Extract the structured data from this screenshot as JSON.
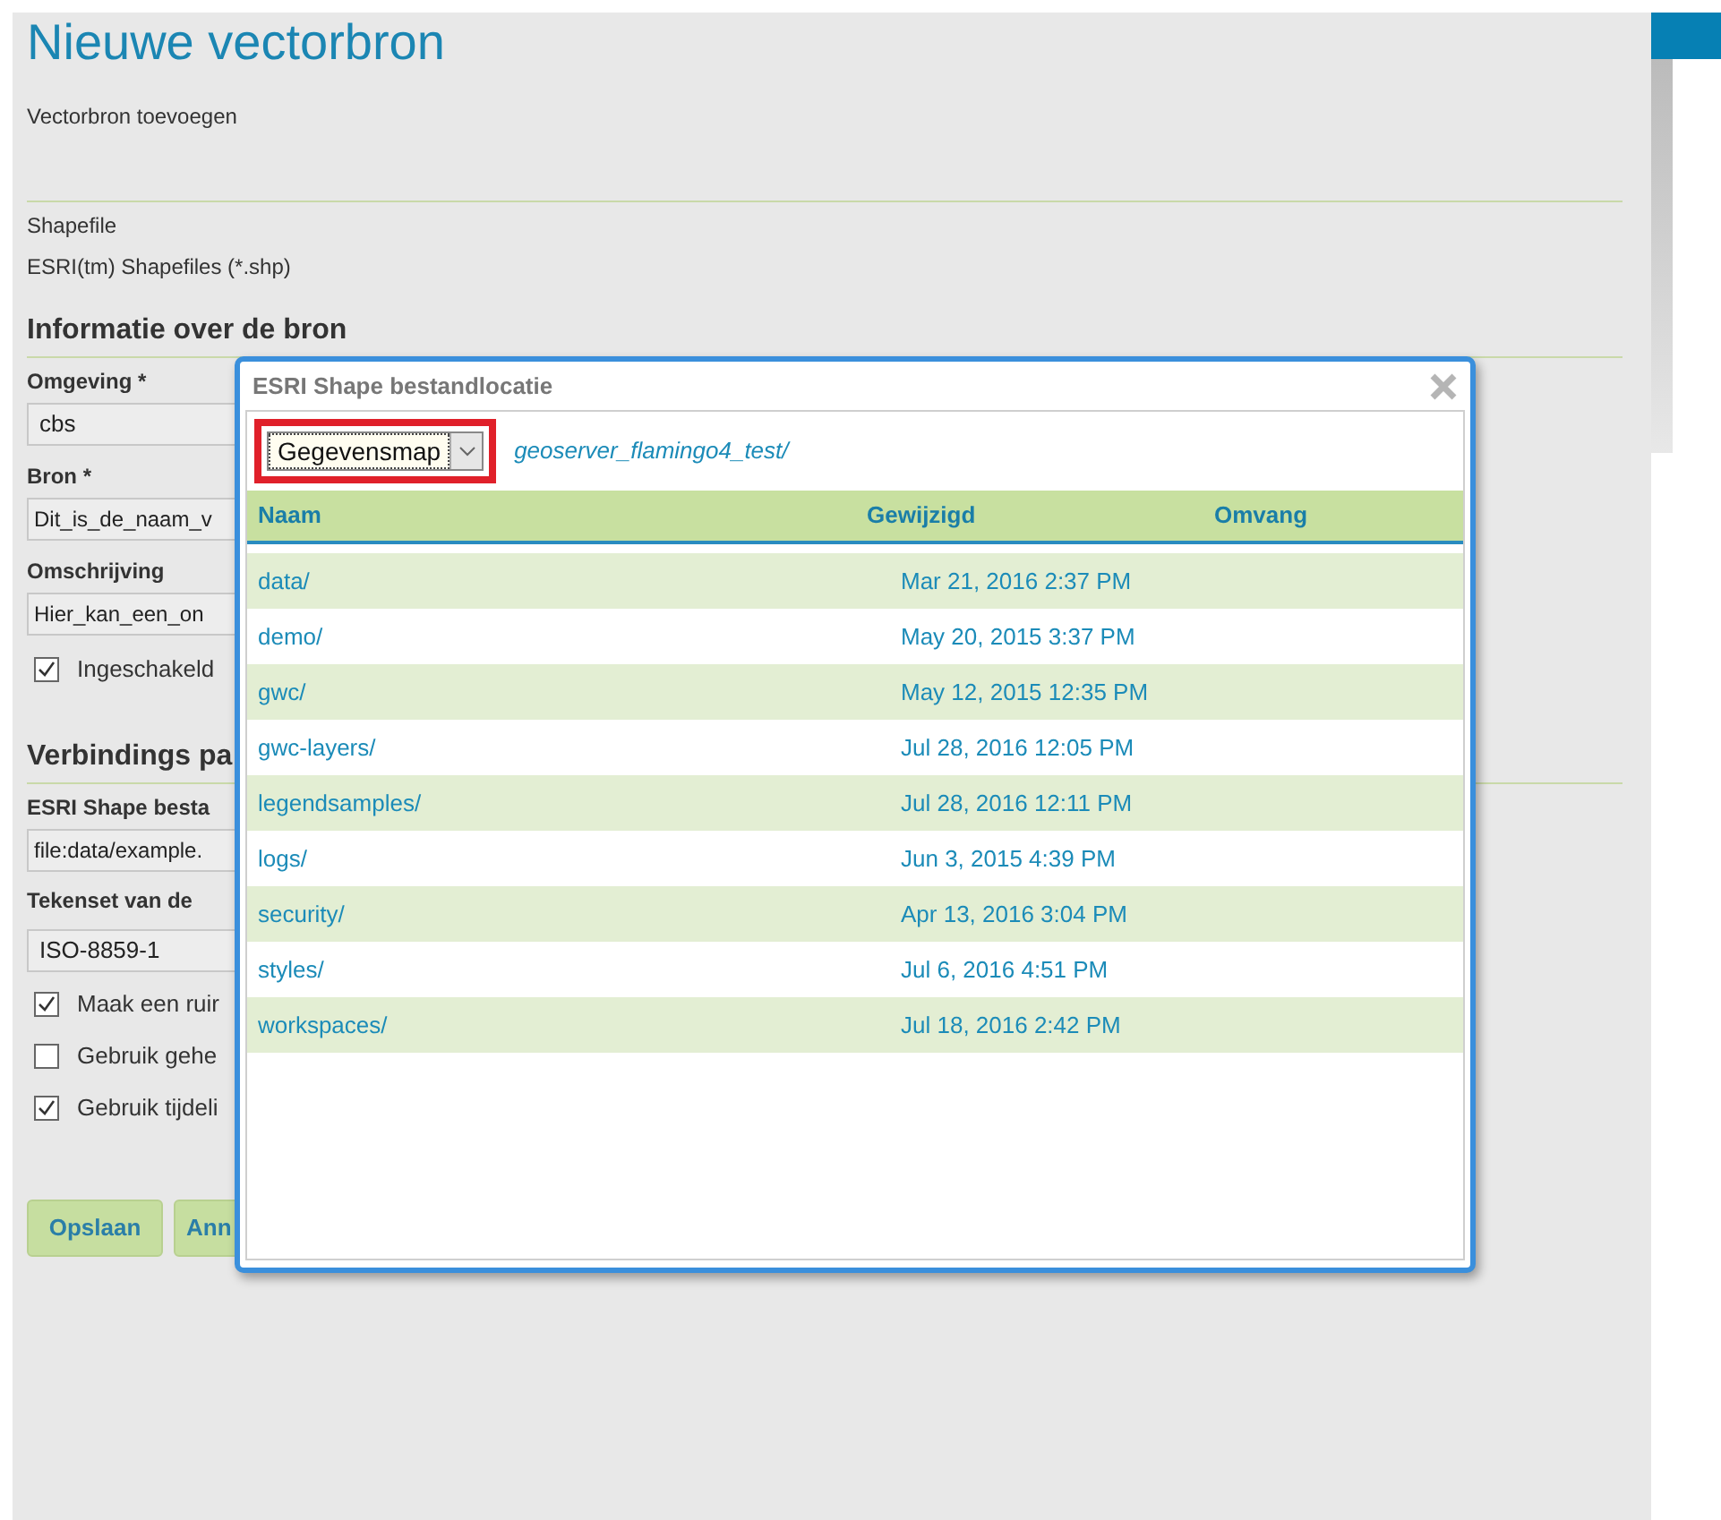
{
  "page": {
    "title": "Nieuwe vectorbron",
    "subtitle": "Vectorbron toevoegen",
    "type_label": "Shapefile",
    "type_description": "ESRI(tm) Shapefiles (*.shp)"
  },
  "sections": [
    {
      "heading": "Informatie over de bron",
      "items": [
        {
          "kind": "select",
          "label": "Omgeving *",
          "value": "cbs"
        },
        {
          "kind": "input",
          "label": "Bron *",
          "value": "Dit_is_de_naam_v"
        },
        {
          "kind": "input",
          "label": "Omschrijving",
          "value": "Hier_kan_een_on"
        },
        {
          "kind": "checkbox",
          "label": "Ingeschakeld",
          "checked": true
        }
      ]
    },
    {
      "heading": "Verbindings pa",
      "items": [
        {
          "kind": "input",
          "label": "ESRI Shape besta",
          "value": "file:data/example."
        },
        {
          "kind": "label",
          "label": "Tekenset van de"
        },
        {
          "kind": "select",
          "value": "ISO-8859-1"
        },
        {
          "kind": "checkbox",
          "label": "Maak een ruir",
          "checked": true
        },
        {
          "kind": "checkbox",
          "label": "Gebruik gehe",
          "checked": false
        },
        {
          "kind": "checkbox",
          "label": "Gebruik tijdeli",
          "checked": true
        }
      ]
    }
  ],
  "buttons": [
    "Opslaan",
    "Ann"
  ],
  "dialog": {
    "title": "ESRI Shape bestandlocatie",
    "location_select": "Gegevensmap",
    "path": "geoserver_flamingo4_test/",
    "columns": [
      "Naam",
      "Gewijzigd",
      "Omvang"
    ],
    "rows": [
      {
        "name": "data/",
        "modified": "Mar 21, 2016 2:37 PM"
      },
      {
        "name": "demo/",
        "modified": "May 20, 2015 3:37 PM"
      },
      {
        "name": "gwc/",
        "modified": "May 12, 2015 12:35 PM"
      },
      {
        "name": "gwc-layers/",
        "modified": "Jul 28, 2016 12:05 PM"
      },
      {
        "name": "legendsamples/",
        "modified": "Jul 28, 2016 12:11 PM"
      },
      {
        "name": "logs/",
        "modified": "Jun 3, 2015 4:39 PM"
      },
      {
        "name": "security/",
        "modified": "Apr 13, 2016 3:04 PM"
      },
      {
        "name": "styles/",
        "modified": "Jul 6, 2016 4:51 PM"
      },
      {
        "name": "workspaces/",
        "modified": "Jul 18, 2016 2:42 PM"
      }
    ]
  }
}
